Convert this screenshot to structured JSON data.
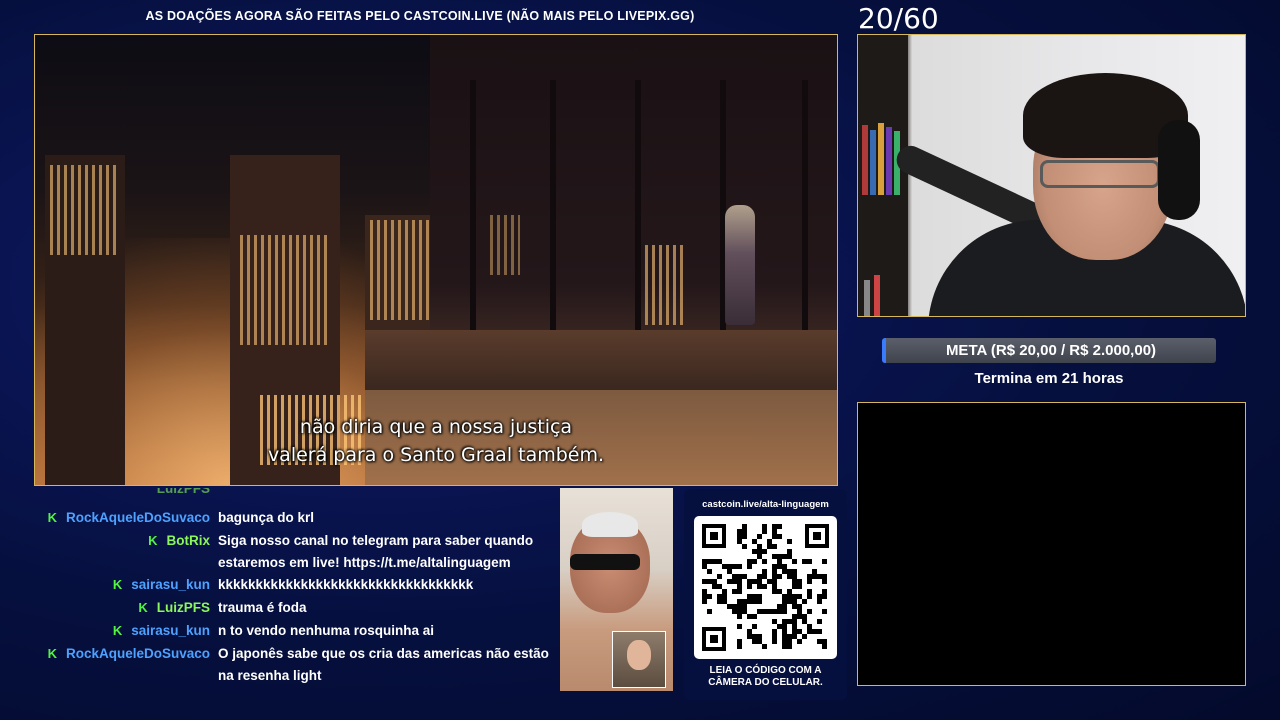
{
  "banner": "AS DOAÇÕES AGORA SÃO FEITAS PELO CASTCOIN.LIVE (NÃO MAIS PELO LIVEPIX.GG)",
  "counter": "20/60",
  "video": {
    "subtitle_line1": "não diria que a nossa justiça",
    "subtitle_line2": "valerá para o Santo Graal também."
  },
  "meta": {
    "label": "META (R$ 20,00 / R$ 2.000,00)",
    "ends": "Termina em 21 horas",
    "accent": "#3b7cff"
  },
  "chat": {
    "messages": [
      {
        "user": "RockAqueleDoSuvaco",
        "text": "bagunça do krl",
        "color": "#4ea2ff"
      },
      {
        "user": "BotRix",
        "text": "Siga nosso canal no telegram para saber quando estaremos em live! https://t.me/altalinguagem",
        "color": "#8cf75b"
      },
      {
        "user": "sairasu_kun",
        "text": "kkkkkkkkkkkkkkkkkkkkkkkkkkkkkkkkkk",
        "color": "#4ea2ff"
      },
      {
        "user": "LuizPFS",
        "text": "trauma é foda",
        "color": "#8cf75b"
      },
      {
        "user": "sairasu_kun",
        "text": "n to vendo nenhuma rosquinha ai",
        "color": "#4ea2ff"
      },
      {
        "user": "RockAqueleDoSuvaco",
        "text": "O japonês sabe que os cria das americas não estão na resenha light",
        "color": "#4ea2ff"
      }
    ],
    "platform_icon": "kick-icon",
    "platform_badge": "K"
  },
  "qr": {
    "url": "castcoin.live/alta-linguagem",
    "caption_line1": "LEIA O CÓDIGO COM A",
    "caption_line2": "CÂMERA DO CELULAR."
  },
  "colors": {
    "frame_border": "#d8b65a",
    "kick_green": "#52f441"
  }
}
